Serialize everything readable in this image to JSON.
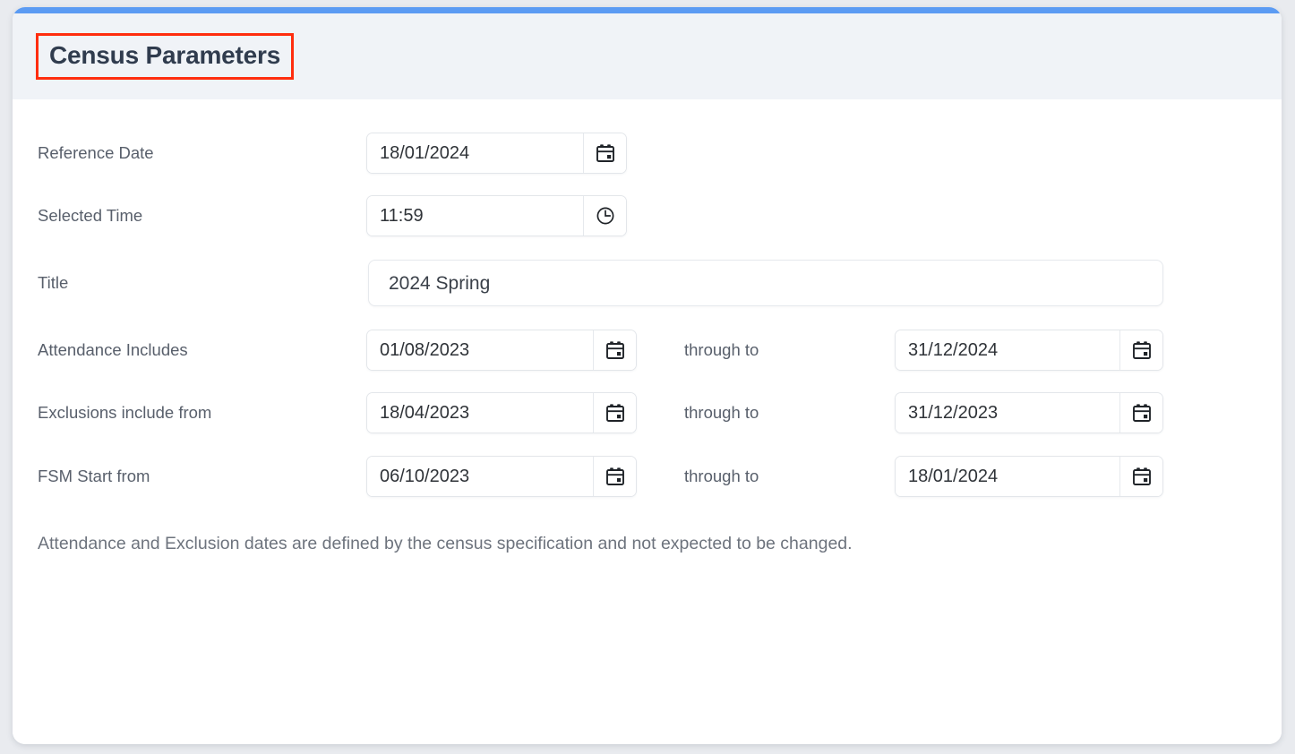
{
  "card": {
    "accent_color": "#5b9bf3",
    "header": {
      "title": "Census Parameters",
      "highlight_color": "#ff2d0e"
    }
  },
  "form": {
    "rows": [
      {
        "label": "Reference Date",
        "value": "18/01/2024",
        "icon": "calendar-icon"
      },
      {
        "label": "Selected Time",
        "value": "11:59",
        "icon": "clock-icon"
      },
      {
        "label": "Title",
        "value": "2024 Spring"
      },
      {
        "label": "Attendance Includes",
        "value": "01/08/2023",
        "separator": "through to",
        "value_to": "31/12/2024",
        "icon": "calendar-icon"
      },
      {
        "label": "Exclusions include from",
        "value": "18/04/2023",
        "separator": "through to",
        "value_to": "31/12/2023",
        "icon": "calendar-icon"
      },
      {
        "label": "FSM Start from",
        "value": "06/10/2023",
        "separator": "through to",
        "value_to": "18/01/2024",
        "icon": "calendar-icon"
      }
    ]
  },
  "note": "Attendance and Exclusion dates are defined by the census specification and not expected to be changed."
}
